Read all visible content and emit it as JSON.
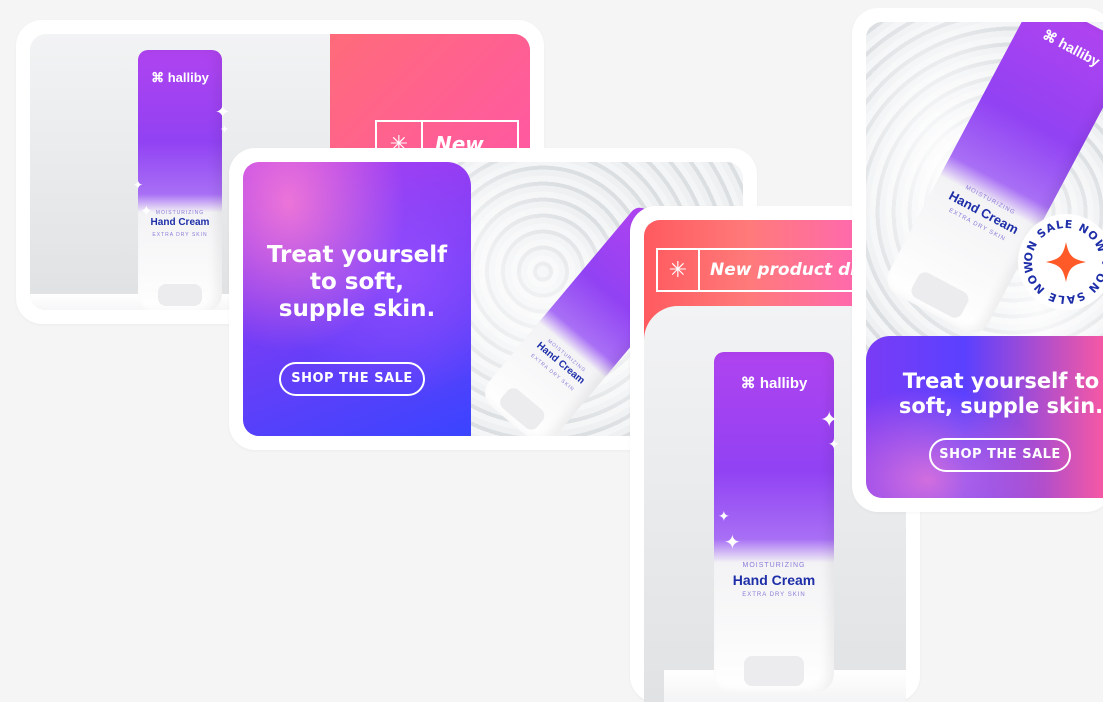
{
  "brand": "halliby",
  "product": {
    "descriptor": "MOISTURIZING",
    "name": "Hand Cream",
    "variant": "EXTRA DRY SKIN"
  },
  "card1": {
    "new_label": "New"
  },
  "card2": {
    "headline_lines": [
      "Treat yourself",
      "to soft,",
      "supple skin."
    ],
    "cta": "SHOP THE SALE"
  },
  "card3": {
    "new_label": "New product dr"
  },
  "card4": {
    "headline_lines": [
      "Treat yourself to",
      "soft, supple skin."
    ],
    "cta": "SHOP THE SALE",
    "badge": "ON SALE NOW • ON SALE NOW •"
  },
  "icons": {
    "asterisk": "✳",
    "sparkle": "✦",
    "brand_mark": "⌘"
  },
  "colors": {
    "purple": "#9142f3",
    "blue": "#3a44ff",
    "coral": "#ff5a5f",
    "pink": "#ff62c5",
    "badge_orange": "#ff5a28",
    "navy": "#1d2ea8"
  }
}
